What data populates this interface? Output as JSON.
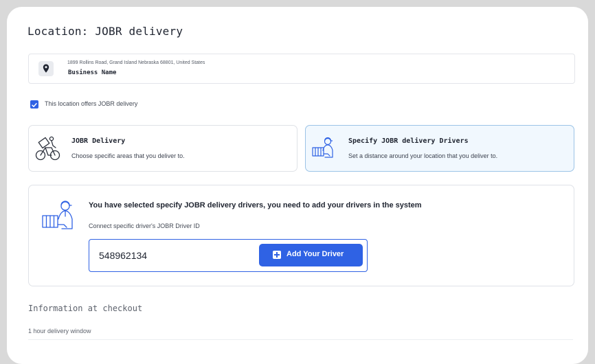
{
  "page": {
    "title": "Location: JOBR delivery"
  },
  "address": {
    "line": "1899 Rollins Road, Grand Island Nebraska 68801, United States",
    "business_name": "Business Name"
  },
  "offers_delivery": {
    "checked": true,
    "label": "This location offers JOBR delivery"
  },
  "delivery_options": [
    {
      "title": "JOBR Delivery",
      "description": "Choose specific areas that you deliver to.",
      "selected": false,
      "icon": "delivery-bike-icon"
    },
    {
      "title": "Specify JOBR delivery Drivers",
      "description": "Set a distance around your location that you deliver to.",
      "selected": true,
      "icon": "driver-icon"
    }
  ],
  "drivers": {
    "message": "You have selected specify JOBR delivery drivers, you need to add your drivers in the system",
    "connect_label": "Connect specific driver's JOBR Driver ID",
    "driver_id_value": "548962134",
    "add_button_label": "Add Your Driver",
    "icon": "driver-icon"
  },
  "checkout": {
    "section_title": "Information at checkout",
    "delivery_window_label": "1 hour delivery window"
  },
  "colors": {
    "accent": "#2F62E4",
    "selected_card_bg": "#F1F8FE",
    "selected_card_border": "#9BC3E6"
  }
}
